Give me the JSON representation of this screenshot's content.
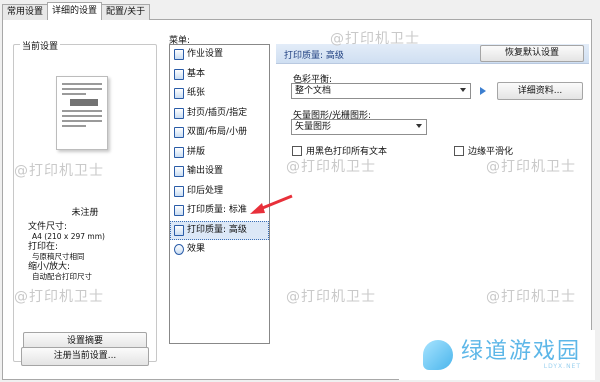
{
  "tabs": [
    "常用设置",
    "详细的设置",
    "配置/关于"
  ],
  "left_panel": {
    "group_title": "当前设置",
    "profile_name": "未注册",
    "info": {
      "paper_size_label": "文件尺寸:",
      "paper_size_value": "A4 (210 x 297 mm)",
      "print_on_label": "打印在:",
      "print_on_value": "与原稿尺寸相同",
      "scale_label": "缩小/放大:",
      "scale_value": "自动配合打印尺寸"
    },
    "summary_button": "设置摘要",
    "register_button": "注册当前设置..."
  },
  "menu": {
    "label": "菜单:",
    "items": [
      {
        "label": "作业设置",
        "icon": "job-settings-icon"
      },
      {
        "label": "基本",
        "icon": "basic-icon"
      },
      {
        "label": "纸张",
        "icon": "paper-icon"
      },
      {
        "label": "封页/插页/指定",
        "icon": "cover-page-icon"
      },
      {
        "label": "双面/布局/小册",
        "icon": "duplex-layout-icon"
      },
      {
        "label": "拼版",
        "icon": "imposition-icon"
      },
      {
        "label": "输出设置",
        "icon": "output-icon"
      },
      {
        "label": "印后处理",
        "icon": "finishing-icon"
      },
      {
        "label": "打印质量: 标准",
        "icon": "quality-standard-icon"
      },
      {
        "label": "打印质量: 高级",
        "icon": "quality-advanced-icon",
        "selected": true
      },
      {
        "label": "效果",
        "icon": "effects-icon"
      }
    ]
  },
  "settings": {
    "header_title": "打印质量: 高级",
    "restore_button": "恢复默认设置",
    "color_balance_label": "色彩平衡:",
    "color_balance_value": "整个文档",
    "details_button": "详细资料...",
    "vector_label": "矢量图形/光栅图形:",
    "vector_value": "矢量图形",
    "black_text_label": "用黑色打印所有文本",
    "edge_smoothing_label": "边缘平滑化"
  },
  "watermark": "@打印机卫士",
  "logo": {
    "text": "绿道游戏园",
    "sub": "LDYX.NET"
  },
  "colors": {
    "accent": "#2a5ca8",
    "annotation_arrow": "#e8303a",
    "logo": "#5db7e8"
  }
}
